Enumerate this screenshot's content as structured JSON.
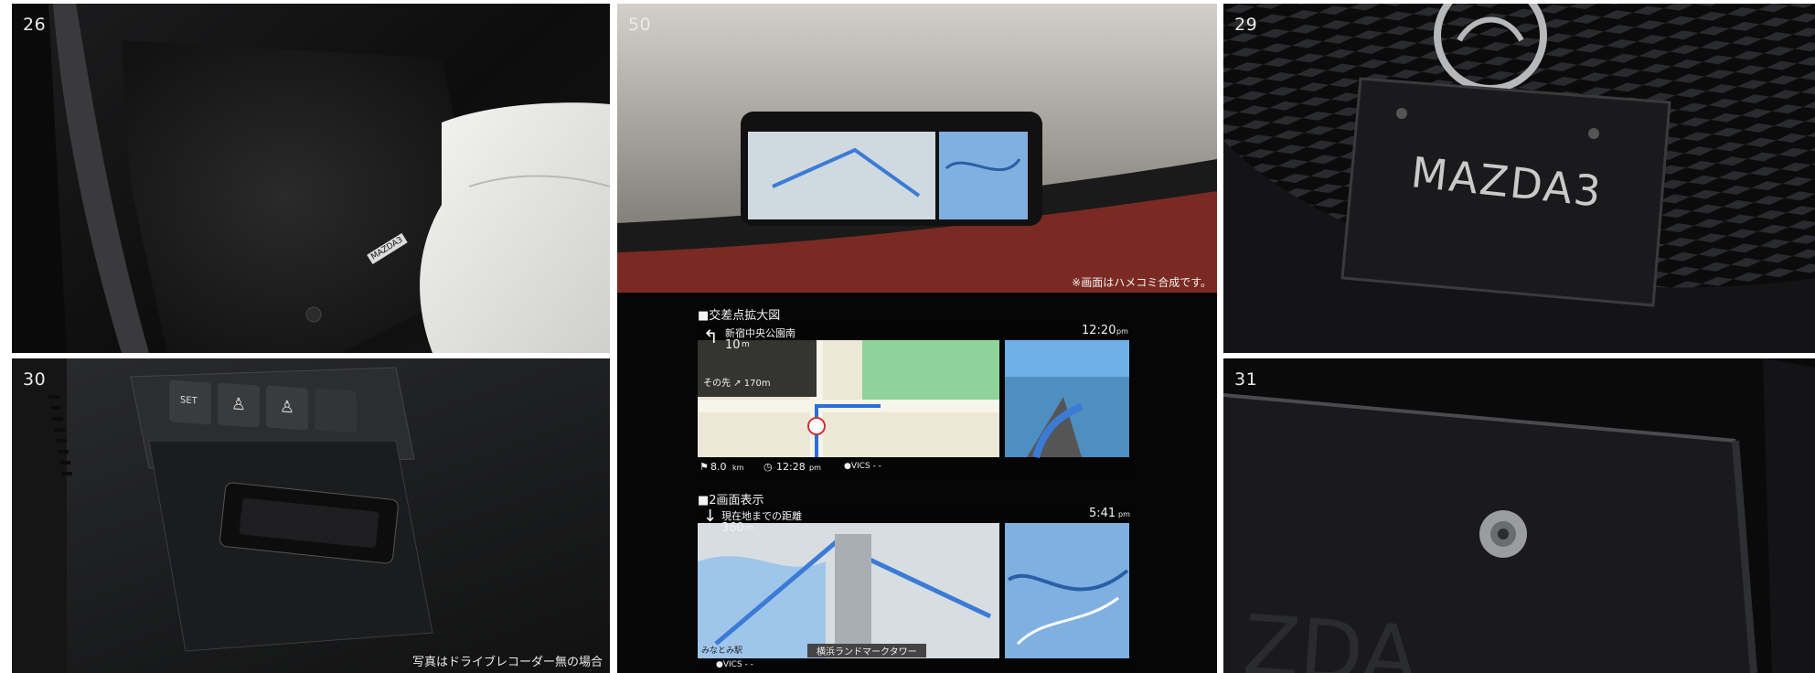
{
  "panels": {
    "floor_mat": {
      "number": "26",
      "mat_logo": "MAZDA3"
    },
    "switch_panel": {
      "number": "30",
      "switch_label": "SET",
      "caption": "写真はドライブレコーダー無の場合"
    },
    "navigation": {
      "number": "50",
      "overlay_note": "※画面はハメコミ合成です。",
      "intersection_title": "■交差点拡大図",
      "intersection_map": {
        "street": "新宿中央公園南",
        "distance": "10",
        "distance_unit": "m",
        "next_turn": "その先 ↗ 170m",
        "time": "12:20",
        "time_unit": "pm",
        "remaining": "8.0",
        "remaining_unit": "km",
        "arrival": "12:28",
        "arrival_unit": "pm",
        "vics": "●VICS - -"
      },
      "split_title": "■2画面表示",
      "split_map": {
        "label": "現在地までの距離",
        "distance": "360",
        "distance_unit": "m",
        "time": "5:41",
        "time_unit": "pm",
        "landmark": "横浜ランドマークタワー",
        "station": "みなとみ駅",
        "vics": "●VICS - -"
      }
    },
    "plate_frame_front": {
      "number": "29",
      "plate_text": "MAZDA3"
    },
    "plate_frame_bolt": {
      "number": "31"
    }
  },
  "colors": {
    "dashboard_red": "#7a2a22",
    "map_water": "#3b7bd6",
    "map_green": "#7fcf86"
  }
}
